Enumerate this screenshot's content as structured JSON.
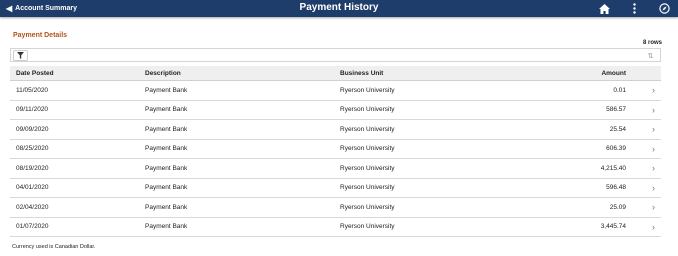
{
  "header": {
    "back_label": "Account Summary",
    "title": "Payment History",
    "icons": [
      "home-icon",
      "more-vertical-icon",
      "navbar-compass-icon"
    ]
  },
  "section_title": "Payment Details",
  "rows_count": "8 rows",
  "columns": {
    "date": "Date Posted",
    "description": "Description",
    "business_unit": "Business Unit",
    "amount": "Amount"
  },
  "rows": [
    {
      "date": "11/05/2020",
      "description": "Payment Bank",
      "business_unit": "Ryerson University",
      "amount": "0.01"
    },
    {
      "date": "09/11/2020",
      "description": "Payment Bank",
      "business_unit": "Ryerson University",
      "amount": "586.57"
    },
    {
      "date": "09/09/2020",
      "description": "Payment Bank",
      "business_unit": "Ryerson University",
      "amount": "25.54"
    },
    {
      "date": "08/25/2020",
      "description": "Payment Bank",
      "business_unit": "Ryerson University",
      "amount": "606.39"
    },
    {
      "date": "08/19/2020",
      "description": "Payment Bank",
      "business_unit": "Ryerson University",
      "amount": "4,215.40"
    },
    {
      "date": "04/01/2020",
      "description": "Payment Bank",
      "business_unit": "Ryerson University",
      "amount": "596.48"
    },
    {
      "date": "02/04/2020",
      "description": "Payment Bank",
      "business_unit": "Ryerson University",
      "amount": "25.09"
    },
    {
      "date": "01/07/2020",
      "description": "Payment Bank",
      "business_unit": "Ryerson University",
      "amount": "3,445.74"
    }
  ],
  "footnote": "Currency used is Canadian Dollar.",
  "colors": {
    "header_bg": "#1f3d6b",
    "section_title": "#b3541a"
  }
}
